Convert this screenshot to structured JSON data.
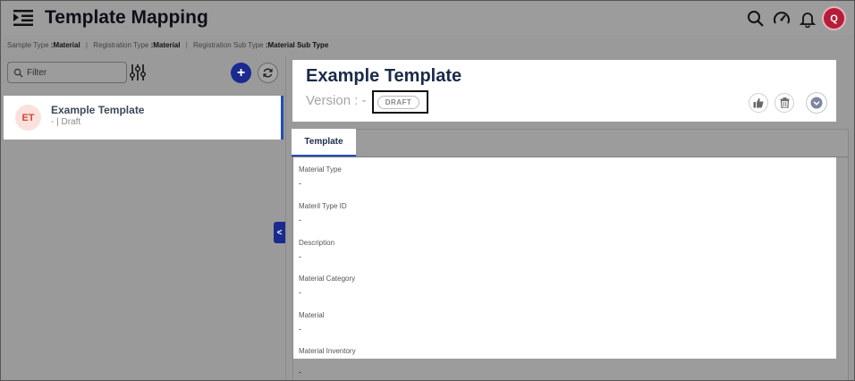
{
  "header": {
    "title": "Template Mapping",
    "avatar_initial": "Q",
    "icons": [
      "menu-icon",
      "search-icon",
      "dashboard-gauge-icon",
      "bell-icon"
    ]
  },
  "breadcrumb": {
    "sample_type_key": "Sample Type",
    "sample_type_val": ":Material",
    "registration_type_key": "Registration Type",
    "registration_type_val": ":Material",
    "registration_sub_type_key": "Registration Sub Type",
    "registration_sub_type_val": ":Material Sub Type",
    "separator": "|"
  },
  "sidebar": {
    "filter_placeholder": "Filter",
    "add_label": "+",
    "items": [
      {
        "initials": "ET",
        "title": "Example Template",
        "subtitle": "- | Draft"
      }
    ],
    "collapse_label": "<"
  },
  "detail": {
    "title": "Example Template",
    "version_label": "Version : -",
    "status_badge": "DRAFT",
    "tabs": [
      {
        "label": "Template"
      }
    ],
    "fields": [
      {
        "label": "Material Type",
        "value": "-"
      },
      {
        "label": "Materil Type ID",
        "value": "-"
      },
      {
        "label": "Description",
        "value": "-"
      },
      {
        "label": "Material Category",
        "value": "-"
      },
      {
        "label": "Material",
        "value": "-"
      },
      {
        "label": "Material Inventory",
        "value": "-"
      }
    ]
  },
  "colors": {
    "accent": "#1a2a8f",
    "avatar_bg": "#b51d3a",
    "active_border": "#1f4dbf",
    "overlay": "#9c9c9c"
  }
}
